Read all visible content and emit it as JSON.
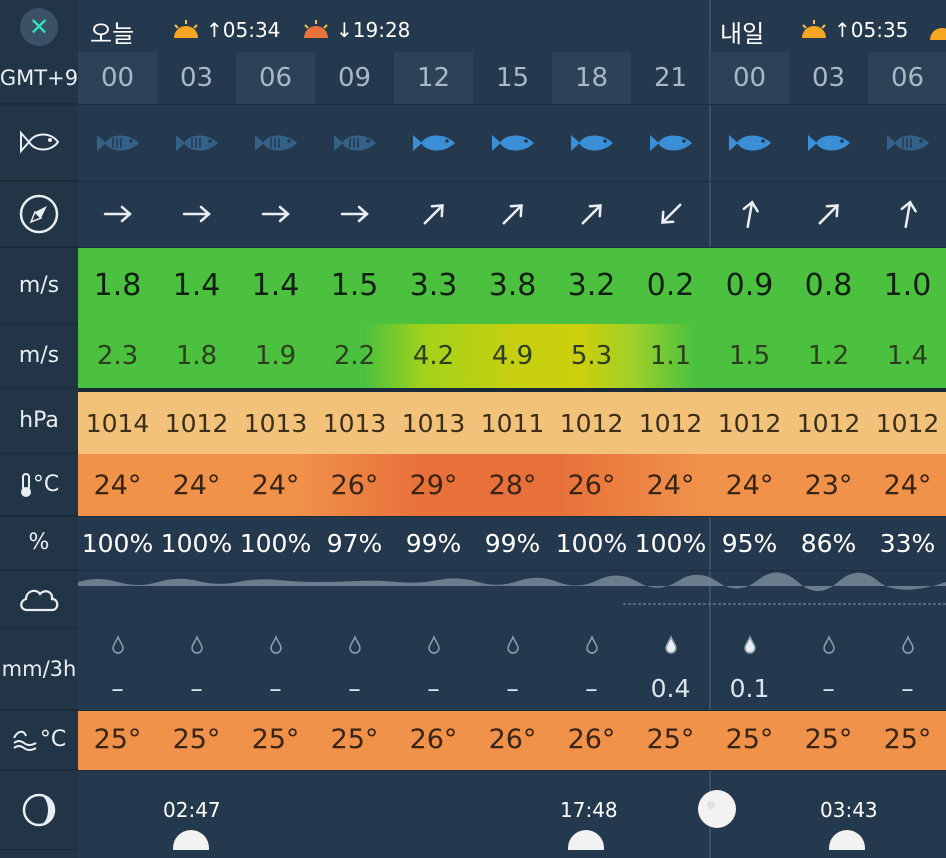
{
  "header": {
    "today_label": "오늘",
    "today_sunrise": "05:34",
    "today_sunset": "19:28",
    "tomorrow_label": "내일",
    "tomorrow_sunrise": "05:35",
    "timezone": "GMT+9"
  },
  "hours": [
    "00",
    "03",
    "06",
    "09",
    "12",
    "15",
    "18",
    "21",
    "00",
    "03",
    "06"
  ],
  "fish_activity": [
    "low",
    "low",
    "low",
    "low",
    "high",
    "high",
    "high",
    "high",
    "high",
    "high",
    "low"
  ],
  "wind_direction": [
    "E",
    "E",
    "E",
    "E",
    "NE",
    "NE",
    "NE",
    "SW",
    "N",
    "NE",
    "N"
  ],
  "units": {
    "wind": "m/s",
    "gust": "m/s",
    "pressure": "hPa",
    "temperature": "°C",
    "humidity": "%",
    "precip": "mm/3h",
    "water_temp": "°C"
  },
  "wind_speed": [
    "1.8",
    "1.4",
    "1.4",
    "1.5",
    "3.3",
    "3.8",
    "3.2",
    "0.2",
    "0.9",
    "0.8",
    "1.0"
  ],
  "wind_gust": [
    "2.3",
    "1.8",
    "1.9",
    "2.2",
    "4.2",
    "4.9",
    "5.3",
    "1.1",
    "1.5",
    "1.2",
    "1.4"
  ],
  "pressure": [
    "1014",
    "1012",
    "1013",
    "1013",
    "1013",
    "1011",
    "1012",
    "1012",
    "1012",
    "1012",
    "1012"
  ],
  "air_temp": [
    "24°",
    "24°",
    "24°",
    "26°",
    "29°",
    "28°",
    "26°",
    "24°",
    "24°",
    "23°",
    "24°"
  ],
  "humidity": [
    "100%",
    "100%",
    "100%",
    "97%",
    "99%",
    "99%",
    "100%",
    "100%",
    "95%",
    "86%",
    "33%"
  ],
  "precip": [
    "–",
    "–",
    "–",
    "–",
    "–",
    "–",
    "–",
    "0.4",
    "0.1",
    "–",
    "–"
  ],
  "water_temp": [
    "25°",
    "25°",
    "25°",
    "25°",
    "26°",
    "26°",
    "26°",
    "25°",
    "25°",
    "25°",
    "25°"
  ],
  "moon": {
    "moonset_1": "02:47",
    "moonrise": "17:48",
    "moonset_2": "03:43"
  },
  "colors": {
    "accent": "#2ee6b8",
    "wind_green": "#4cc13f",
    "gust_yellow": "#c6cf10",
    "pressure": "#f3c27a",
    "temp_orange": "#f0924a",
    "temp_hot": "#e8703a"
  },
  "icons": {
    "close": "close-icon",
    "fish": "fish-icon",
    "compass": "compass-icon",
    "thermometer": "thermometer-icon",
    "cloud": "cloud-icon",
    "waves": "waves-icon",
    "moon": "moon-phase-icon"
  }
}
